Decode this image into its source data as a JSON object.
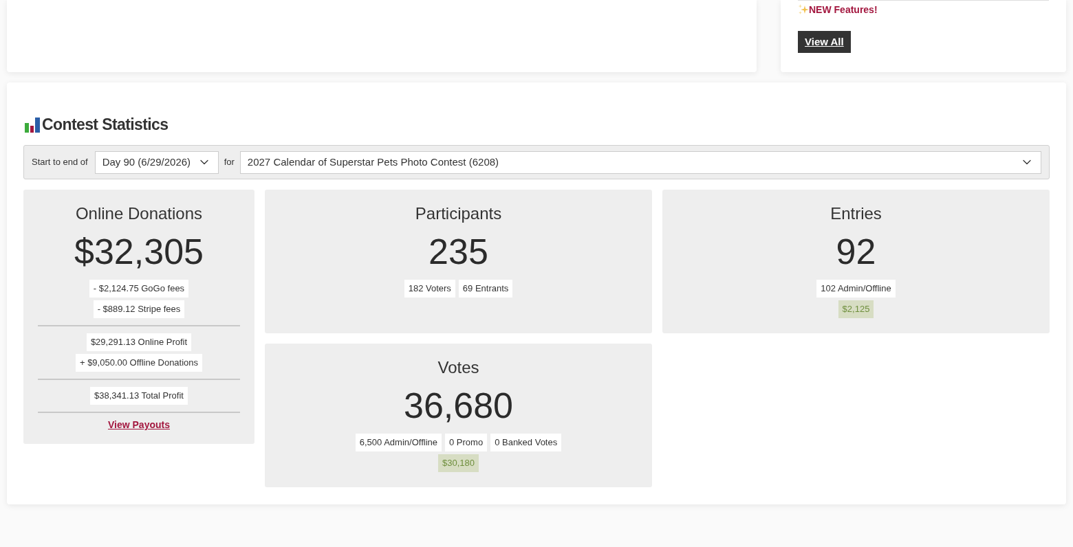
{
  "news_panel": {
    "items": [
      {
        "label": "NEW Features!"
      }
    ],
    "view_all_button": "View All"
  },
  "contest_statistics": {
    "title": "Contest Statistics",
    "filter": {
      "label": "Start to end of",
      "period_select": "Day 90 (6/29/2026)",
      "for_label": "for",
      "contest_select": "2027 Calendar of Superstar Pets Photo Contest (6208)"
    }
  },
  "donations_card": {
    "title": "Online Donations",
    "value": "$32,305",
    "groups": [
      {
        "lines": [
          "- $2,124.75 GoGo fees",
          "- $889.12 Stripe fees"
        ]
      },
      {
        "lines": [
          "$29,291.13 Online Profit",
          "+ $9,050.00 Offline Donations"
        ]
      },
      {
        "lines": [
          "$38,341.13 Total Profit"
        ]
      }
    ],
    "link": "View Payouts"
  },
  "stat_cards": [
    {
      "title": "Participants",
      "value": "235",
      "details": [
        "182 Voters",
        "69 Entrants"
      ]
    },
    {
      "title": "Entries",
      "value": "92",
      "details": [
        "102 Admin/Offline"
      ],
      "amount": "$2,125"
    },
    {
      "title": "Votes",
      "value": "36,680",
      "details": [
        "6,500 Admin/Offline",
        "0 Promo",
        "0 Banked Votes"
      ],
      "amount": "$30,180"
    }
  ]
}
